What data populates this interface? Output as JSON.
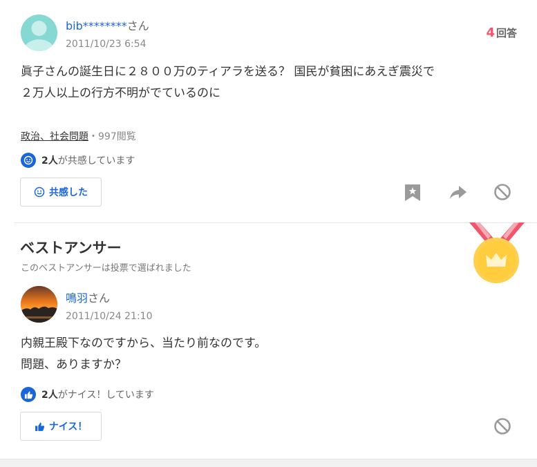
{
  "question": {
    "user_name": "bib********",
    "user_suffix": "さん",
    "date": "2011/10/23 6:54",
    "answer_count": "4",
    "answer_label": "回答",
    "text_line1": "眞子さんの誕生日に２８００万のティアラを送る？ 国民が貧困にあえぎ震災で",
    "text_line2": "２万人以上の行方不明がでているのに",
    "category": "政治、社会問題",
    "separator": "・",
    "views": "997閲覧",
    "empathy_count": "2人",
    "empathy_text": "が共感しています",
    "empathy_button": "共感した"
  },
  "best_answer": {
    "heading": "ベストアンサー",
    "subheading": "このベストアンサーは投票で選ばれました",
    "user_name": "鳴羽",
    "user_suffix": "さん",
    "date": "2011/10/24 21:10",
    "text_line1": "内親王殿下なのですから、当たり前なのです。",
    "text_line2": "問題、ありますか？",
    "nice_count": "2人",
    "nice_text": "がナイス！しています",
    "nice_button": "ナイス！"
  },
  "colors": {
    "link": "#1a66d8",
    "accent_red": "#f0566a",
    "medal_gold": "#ffd04f"
  }
}
